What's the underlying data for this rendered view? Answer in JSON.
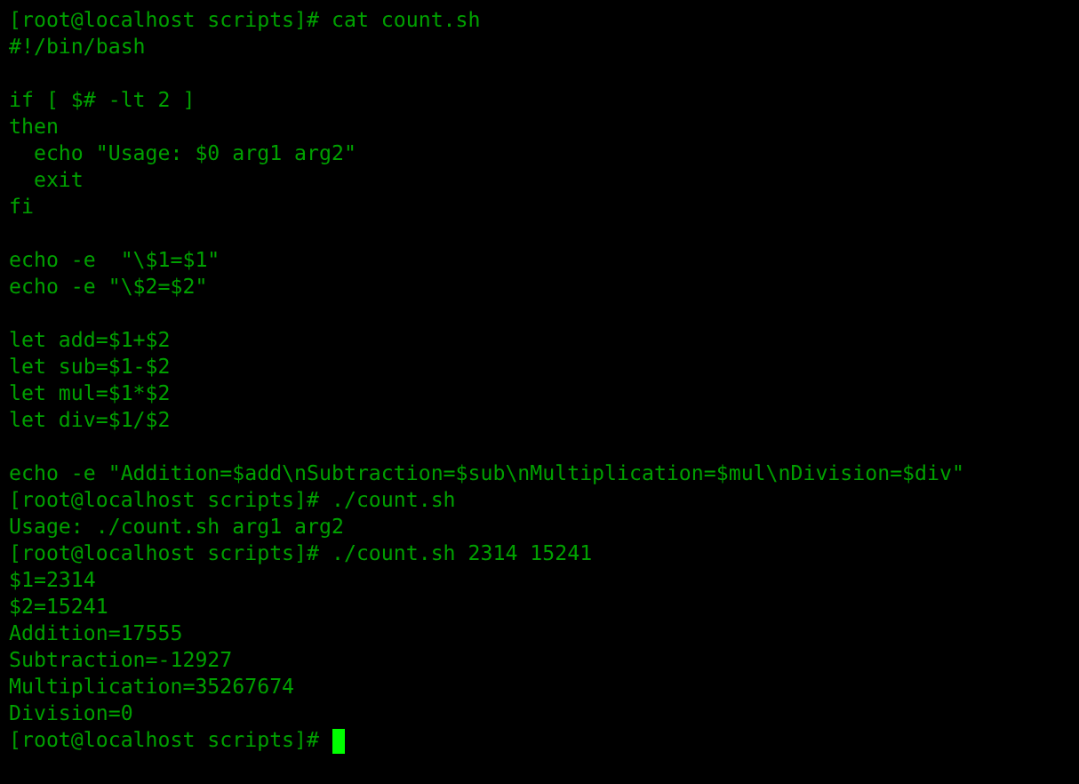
{
  "terminal": {
    "blocks": [
      {
        "lines": [
          "[root@localhost scripts]# cat count.sh",
          "#!/bin/bash"
        ]
      },
      {
        "lines": [
          "if [ $# -lt 2 ]",
          "then",
          "  echo \"Usage: $0 arg1 arg2\"",
          "  exit",
          "fi"
        ]
      },
      {
        "lines": [
          "echo -e  \"\\$1=$1\"",
          "echo -e \"\\$2=$2\""
        ]
      },
      {
        "lines": [
          "let add=$1+$2",
          "let sub=$1-$2",
          "let mul=$1*$2",
          "let div=$1/$2"
        ]
      },
      {
        "lines": [
          "echo -e \"Addition=$add\\nSubtraction=$sub\\nMultiplication=$mul\\nDivision=$div\"",
          "[root@localhost scripts]# ./count.sh",
          "Usage: ./count.sh arg1 arg2",
          "[root@localhost scripts]# ./count.sh 2314 15241",
          "$1=2314",
          "$2=15241",
          "Addition=17555",
          "Subtraction=-12927",
          "Multiplication=35267674",
          "Division=0"
        ]
      }
    ],
    "prompt": {
      "text": "[root@localhost scripts]#",
      "cursor": true
    }
  }
}
